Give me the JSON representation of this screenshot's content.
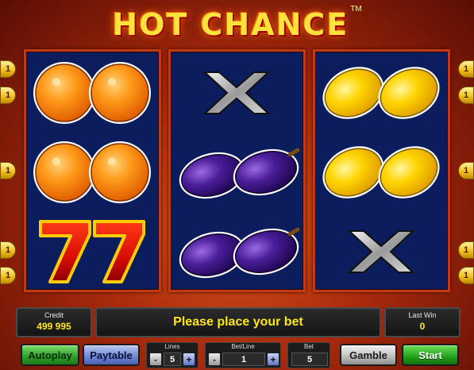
{
  "game": {
    "title": "HOT CHANCE",
    "trademark": "TM",
    "message": "Please place your bet"
  },
  "reels": [
    [
      "orange",
      "orange",
      "seven"
    ],
    [
      "cross",
      "plum",
      "plum"
    ],
    [
      "lemon",
      "lemon",
      "cross"
    ]
  ],
  "paylines": {
    "left": [
      "1",
      "1",
      "1",
      "1",
      "1"
    ],
    "right": [
      "1",
      "1",
      "1",
      "1",
      "1"
    ]
  },
  "stats": {
    "credit_label": "Credit",
    "credit_value": "499 995",
    "last_win_label": "Last Win",
    "last_win_value": "0"
  },
  "bet_controls": {
    "lines_label": "Lines",
    "lines_value": "5",
    "bet_line_label": "Bet/Line",
    "bet_line_value": "1",
    "bet_label": "Bet",
    "bet_value": "5",
    "minus": "-",
    "plus": "+"
  },
  "buttons": {
    "autoplay": "Autoplay",
    "paytable": "Paytable",
    "gamble": "Gamble",
    "start": "Start"
  },
  "colors": {
    "reel_bg": "#0b1d5c",
    "accent_yellow": "#ffe61a",
    "frame_red": "#c03a14"
  }
}
